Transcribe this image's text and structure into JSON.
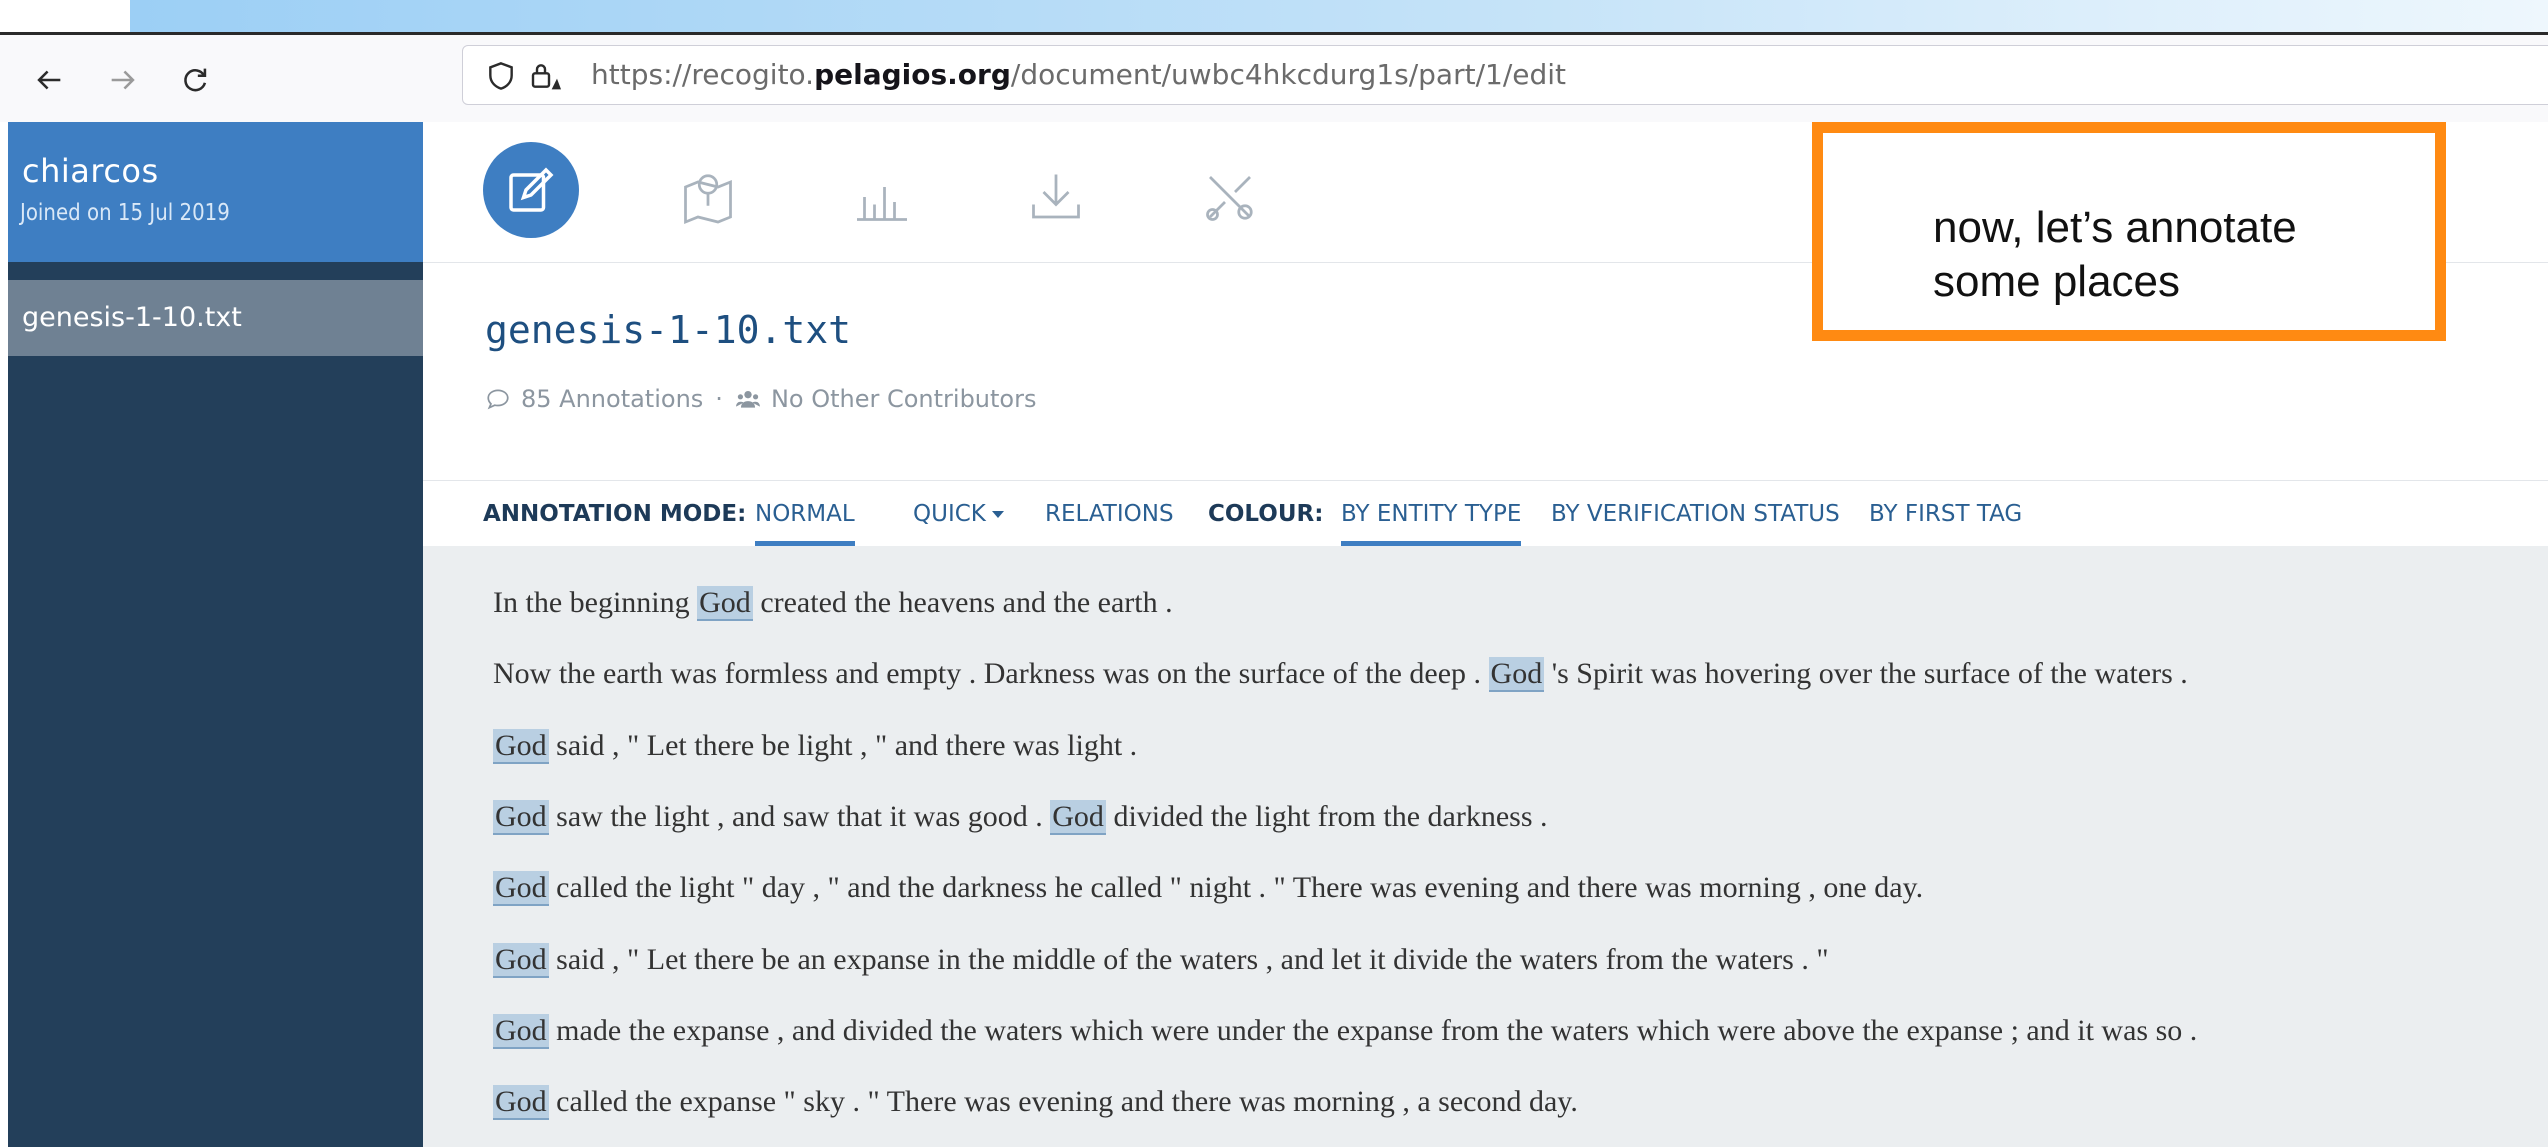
{
  "browser": {
    "url_prefix": "https://recogito.",
    "url_domain": "pelagios.org",
    "url_path": "/document/uwbc4hkcdurg1s/part/1/edit"
  },
  "sidebar": {
    "user_name": "chiarcos",
    "joined": "Joined on 15 Jul 2019",
    "documents": [
      {
        "label": "genesis-1-10.txt"
      }
    ]
  },
  "document": {
    "title": "genesis-1-10.txt",
    "annotations": "85 Annotations",
    "separator": "·",
    "contributors": "No Other Contributors"
  },
  "mode_bar": {
    "annotation_mode_label": "ANNOTATION MODE:",
    "normal": "NORMAL",
    "quick": "QUICK",
    "relations": "RELATIONS",
    "colour_label": "COLOUR:",
    "by_entity_type": "BY ENTITY TYPE",
    "by_verification_status": "BY VERIFICATION STATUS",
    "by_first_tag": "BY FIRST TAG"
  },
  "text": {
    "lines": [
      {
        "segments": [
          {
            "t": "In the beginning "
          },
          {
            "t": "God",
            "ann": true
          },
          {
            "t": " created the heavens and the earth ."
          }
        ]
      },
      {
        "segments": [
          {
            "t": "Now the earth was formless and empty . Darkness was on the surface of the deep . "
          },
          {
            "t": "God",
            "ann": true
          },
          {
            "t": " 's Spirit was hovering over the surface of the waters ."
          }
        ]
      },
      {
        "segments": [
          {
            "t": "God",
            "ann": true
          },
          {
            "t": " said , \" Let there be light , \" and there was light ."
          }
        ]
      },
      {
        "segments": [
          {
            "t": "God",
            "ann": true
          },
          {
            "t": " saw the light , and saw that it was good . "
          },
          {
            "t": "God",
            "ann": true
          },
          {
            "t": " divided the light from the darkness ."
          }
        ]
      },
      {
        "segments": [
          {
            "t": "God",
            "ann": true
          },
          {
            "t": " called the light \" day , \" and the darkness he called \" night . \" There was evening and there was morning , one day."
          }
        ]
      },
      {
        "segments": [
          {
            "t": "God",
            "ann": true
          },
          {
            "t": " said , \" Let there be an expanse in the middle of the waters , and let it divide the waters from the waters . \""
          }
        ]
      },
      {
        "segments": [
          {
            "t": "God",
            "ann": true
          },
          {
            "t": " made the expanse , and divided the waters which were under the expanse from the waters which were above the expanse ; and it was so ."
          }
        ]
      },
      {
        "segments": [
          {
            "t": "God",
            "ann": true
          },
          {
            "t": " called the expanse \" sky . \" There was evening and there was morning , a second day."
          }
        ]
      }
    ]
  },
  "callout": {
    "text": "now, let’s annotate some places"
  },
  "colors": {
    "sidebar": "#233f5a",
    "profile": "#3e7ec2",
    "accent": "#3e7ec2",
    "callout_border": "#ff8a12",
    "annotation": "#b9cfe2"
  },
  "icons": {
    "back": "arrow-left-icon",
    "forward": "arrow-right-icon",
    "reload": "reload-icon",
    "tools": [
      "edit-icon",
      "map-icon",
      "stats-icon",
      "download-icon",
      "settings-tools-icon"
    ]
  }
}
